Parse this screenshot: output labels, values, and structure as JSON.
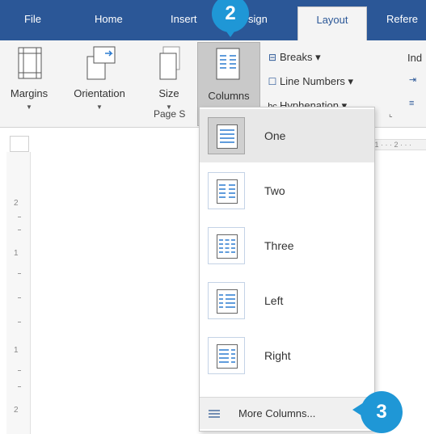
{
  "tabs": [
    {
      "label": "File",
      "active": false
    },
    {
      "label": "Home",
      "active": false
    },
    {
      "label": "Insert",
      "active": false
    },
    {
      "label": "Design",
      "visible_fragment": "sign",
      "active": false
    },
    {
      "label": "Layout",
      "active": true
    },
    {
      "label": "Refere",
      "active": false
    }
  ],
  "ribbon": {
    "buttons": {
      "margins": "Margins",
      "orientation": "Orientation",
      "size": "Size",
      "columns": "Columns"
    },
    "small_buttons": {
      "breaks": "Breaks ▾",
      "line_numbers": "Line Numbers ▾",
      "hyphenation": "Hyphenation ▾"
    },
    "group_label": "Page S",
    "partial_label": "Ind"
  },
  "ruler": {
    "horizontal": "· 1 · · · 2 · · ·",
    "vertical_numbers": [
      "2",
      "1",
      "1",
      "2"
    ]
  },
  "columns_menu": {
    "options": [
      {
        "label": "One",
        "icon": "one-column-icon",
        "selected": true
      },
      {
        "label": "Two",
        "icon": "two-columns-icon",
        "selected": false
      },
      {
        "label": "Three",
        "icon": "three-columns-icon",
        "selected": false
      },
      {
        "label": "Left",
        "icon": "left-column-icon",
        "selected": false
      },
      {
        "label": "Right",
        "icon": "right-column-icon",
        "selected": false
      }
    ],
    "more": "More Columns..."
  },
  "callouts": {
    "step2": "2",
    "step3": "3"
  },
  "colors": {
    "tab_bar": "#2b5797",
    "ribbon": "#f4f4f4",
    "selected_button": "#c9c9c9",
    "callout": "#1f97d6"
  }
}
